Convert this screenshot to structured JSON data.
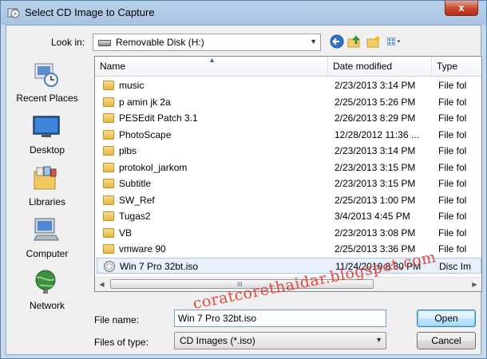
{
  "window": {
    "title": "Select CD Image to Capture",
    "close_label": "x"
  },
  "toolbar": {
    "look_in_label": "Look in:",
    "look_in_value": "Removable Disk (H:)",
    "icons": [
      "back-icon",
      "up-folder-icon",
      "new-folder-icon",
      "views-menu-icon"
    ]
  },
  "places": [
    {
      "label": "Recent Places",
      "icon": "recent-places-icon"
    },
    {
      "label": "Desktop",
      "icon": "desktop-icon"
    },
    {
      "label": "Libraries",
      "icon": "libraries-icon"
    },
    {
      "label": "Computer",
      "icon": "computer-icon"
    },
    {
      "label": "Network",
      "icon": "network-icon"
    }
  ],
  "file_list": {
    "columns": [
      "Name",
      "Date modified",
      "Type"
    ],
    "rows": [
      {
        "name": "music",
        "date": "2/23/2013 3:14 PM",
        "type": "File fol",
        "kind": "folder"
      },
      {
        "name": "p amin jk 2a",
        "date": "2/25/2013 5:26 PM",
        "type": "File fol",
        "kind": "folder"
      },
      {
        "name": "PESEdit Patch 3.1",
        "date": "2/26/2013 8:29 PM",
        "type": "File fol",
        "kind": "folder"
      },
      {
        "name": "PhotoScape",
        "date": "12/28/2012 11:36 ...",
        "type": "File fol",
        "kind": "folder"
      },
      {
        "name": "plbs",
        "date": "2/23/2013 3:14 PM",
        "type": "File fol",
        "kind": "folder"
      },
      {
        "name": "protokol_jarkom",
        "date": "2/23/2013 3:15 PM",
        "type": "File fol",
        "kind": "folder"
      },
      {
        "name": "Subtitle",
        "date": "2/23/2013 3:15 PM",
        "type": "File fol",
        "kind": "folder"
      },
      {
        "name": "SW_Ref",
        "date": "2/25/2013 1:00 PM",
        "type": "File fol",
        "kind": "folder"
      },
      {
        "name": "Tugas2",
        "date": "3/4/2013 4:45 PM",
        "type": "File fol",
        "kind": "folder"
      },
      {
        "name": "VB",
        "date": "2/23/2013 3:08 PM",
        "type": "File fol",
        "kind": "folder"
      },
      {
        "name": "vmware 90",
        "date": "2/25/2013 3:36 PM",
        "type": "File fol",
        "kind": "folder"
      },
      {
        "name": "Win 7 Pro 32bt.iso",
        "date": "11/24/2010 8:30 PM",
        "type": "Disc Im",
        "kind": "disc",
        "selected": true
      }
    ],
    "scroll_grip": "III"
  },
  "form": {
    "file_name_label": "File name:",
    "file_name_value": "Win 7 Pro 32bt.iso",
    "file_type_label": "Files of type:",
    "file_type_value": "CD Images (*.iso)"
  },
  "buttons": {
    "open": "Open",
    "cancel": "Cancel"
  },
  "watermark": "coratcorethaidar.blogspot.com"
}
